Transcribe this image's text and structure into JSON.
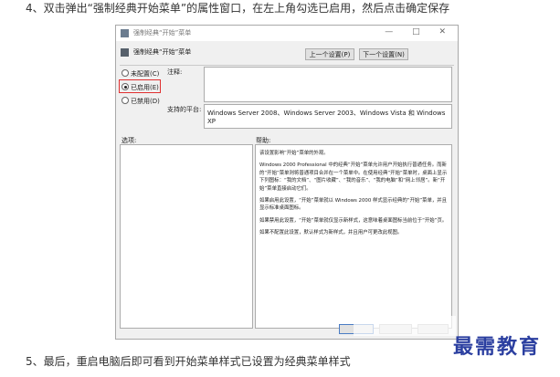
{
  "instructions": {
    "step4": "4、双击弹出“强制经典开始菜单”的属性窗口，在左上角勾选已启用，然后点击确定保存",
    "step5": "5、最后，重启电脑后即可看到开始菜单样式已设置为经典菜单样式"
  },
  "dialog": {
    "window_title": "强制经典“开始”菜单",
    "window_controls": "— □ ✕",
    "header_title": "强制经典“开始”菜单",
    "prev_button": "上一个设置(P)",
    "next_button": "下一个设置(N)",
    "radio_not_configured": "未配置(C)",
    "radio_enabled": "已启用(E)",
    "radio_disabled": "已禁用(D)",
    "selected_option": "已启用(E)",
    "comment_label": "注释:",
    "platform_label": "支持的平台:",
    "platform_value": "Windows Server 2008、Windows Server 2003、Windows Vista 和 Windows XP",
    "options_label": "选项:",
    "help_label": "帮助:",
    "help_text": [
      "该设置影响“开始”菜单的外观。",
      "Windows 2000 Professional 中的经典“开始”菜单允许用户开始执行普通任务。而新的“开始”菜单则将普通项目合并在一个菜单中。在使用经典“开始”菜单时，桌面上显示下列图标：“我的文档”、“图片收藏”、“我的音乐”、“我的电脑”和“网上邻居”。新“开始”菜单直接启动它们。",
      "如果启用此设置，“开始”菜单就以 Windows 2000 样式显示经典的“开始”菜单，并且显示标准桌面图标。",
      "如果禁用此设置，“开始”菜单就仅显示新样式，这意味着桌面图标当前位于“开始”页。",
      "如果不配置此设置，默认样式为新样式，并且用户可更改此视图。"
    ]
  },
  "watermark": "最需教育",
  "colors": {
    "highlight_border": "#e03030",
    "watermark": "#2b3fa0"
  }
}
